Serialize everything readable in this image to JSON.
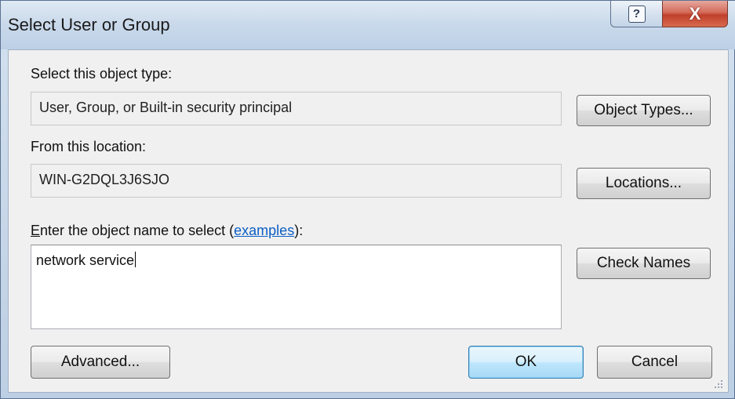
{
  "window": {
    "title": "Select User or Group",
    "help_symbol": "?",
    "close_symbol": "X"
  },
  "object_type": {
    "label": "Select this object type:",
    "value": "User, Group, or Built-in security principal",
    "button": "Object Types..."
  },
  "location": {
    "label": "From this location:",
    "value": "WIN-G2DQL3J6SJO",
    "button": "Locations..."
  },
  "object_name": {
    "label_prefix": "nter the object name to select (",
    "label_accel": "E",
    "link": "examples",
    "label_suffix": "):",
    "value": "network service",
    "button": "Check Names"
  },
  "footer": {
    "advanced": "Advanced...",
    "ok": "OK",
    "cancel": "Cancel"
  },
  "icons": {
    "help": "question-mark-icon",
    "close": "close-x-icon",
    "grip": "resize-grip-icon"
  }
}
